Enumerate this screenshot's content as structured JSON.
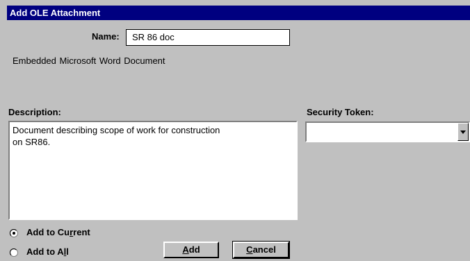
{
  "window": {
    "title": "Add OLE Attachment"
  },
  "name": {
    "label": "Name:",
    "value": "SR 86 doc"
  },
  "object_type": "Embedded  Microsoft Word Document",
  "description": {
    "label": "Description:",
    "value": "Document describing scope of work for construction\non SR86."
  },
  "security_token": {
    "label": "Security Token:",
    "value": ""
  },
  "options": {
    "add_to_current": {
      "pre": "Add to Cu",
      "accel": "r",
      "post": "rent",
      "selected": true
    },
    "add_to_all": {
      "pre": "Add to A",
      "accel": "l",
      "post": "l",
      "selected": false
    }
  },
  "buttons": {
    "add": {
      "accel": "A",
      "rest": "dd"
    },
    "cancel": {
      "accel": "C",
      "rest": "ancel"
    }
  }
}
